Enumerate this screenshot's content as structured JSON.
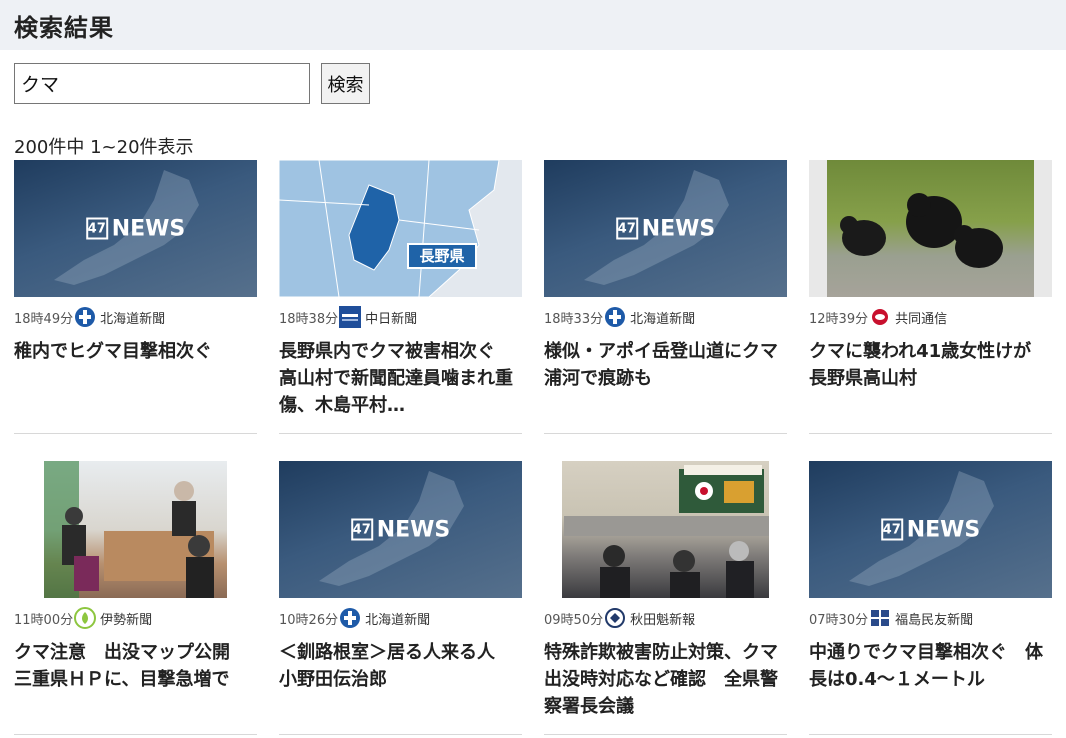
{
  "page": {
    "title": "検索結果"
  },
  "search": {
    "value": "クマ",
    "button_label": "検索"
  },
  "results": {
    "count_text": "200件中 1~20件表示",
    "news47_box": "47",
    "news47_text": "NEWS",
    "map_label": "長野県",
    "items": [
      {
        "time": "18時49分",
        "source": "北海道新聞",
        "title": "稚内でヒグマ目撃相次ぐ",
        "thumb": "news47",
        "icon": "hokkaido-shimbun-icon"
      },
      {
        "time": "18時38分",
        "source": "中日新聞",
        "title": "長野県内でクマ被害相次ぐ　高山村で新聞配達員噛まれ重傷、木島平村…",
        "thumb": "map",
        "icon": "chunichi-shimbun-icon"
      },
      {
        "time": "18時33分",
        "source": "北海道新聞",
        "title": "様似・アポイ岳登山道にクマ　浦河で痕跡も",
        "thumb": "news47",
        "icon": "hokkaido-shimbun-icon"
      },
      {
        "time": "12時39分",
        "source": "共同通信",
        "title": "クマに襲われ41歳女性けが　長野県高山村",
        "thumb": "bear",
        "icon": "kyodo-news-icon"
      },
      {
        "time": "11時00分",
        "source": "伊勢新聞",
        "title": "クマ注意　出没マップ公開　三重県ＨＰに、目撃急増で",
        "thumb": "meeting1",
        "icon": "ise-shimbun-icon"
      },
      {
        "time": "10時26分",
        "source": "北海道新聞",
        "title": "＜釧路根室＞居る人来る人　小野田伝治郎",
        "thumb": "news47",
        "icon": "hokkaido-shimbun-icon"
      },
      {
        "time": "09時50分",
        "source": "秋田魁新報",
        "title": "特殊詐欺被害防止対策、クマ出没時対応など確認　全県警察署長会議",
        "thumb": "meeting2",
        "icon": "akita-sakigake-icon"
      },
      {
        "time": "07時30分",
        "source": "福島民友新聞",
        "title": "中通りでクマ目撃相次ぐ　体長は0.4～１メートル",
        "thumb": "news47",
        "icon": "fukushima-minyu-icon"
      }
    ]
  },
  "colors": {
    "header_bg": "#eef1f5",
    "hokkaido_blue": "#1e5aa8",
    "kyodo_red": "#c8102e"
  }
}
